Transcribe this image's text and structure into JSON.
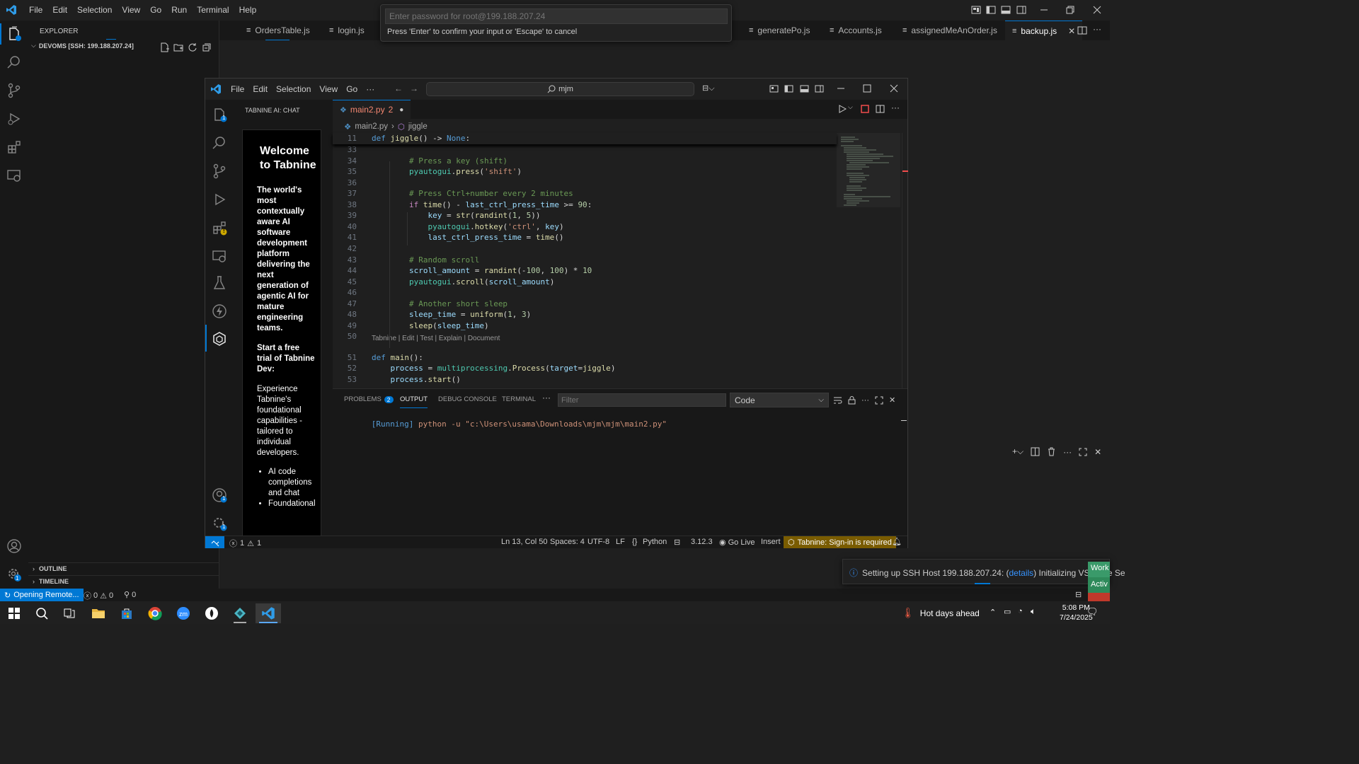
{
  "outer": {
    "menu": [
      "File",
      "Edit",
      "Selection",
      "View",
      "Go",
      "Run",
      "Terminal",
      "Help"
    ],
    "explorer_title": "EXPLORER",
    "folder_label": "DEVOMS [SSH: 199.188.207.24]",
    "outline_label": "OUTLINE",
    "timeline_label": "TIMELINE",
    "tabs": [
      "OrdersTable.js",
      "login.js",
      "generatePo.js",
      "Accounts.js",
      "assignedMeAnOrder.js",
      "backup.js"
    ],
    "status": {
      "remote": "Opening Remote...",
      "errors": "0",
      "warnings": "0",
      "ports": "0"
    },
    "accounts_badge": "1"
  },
  "quick_input": {
    "placeholder": "Enter password for root@199.188.207.24",
    "hint": "Press 'Enter' to confirm your input or 'Escape' to cancel"
  },
  "inner": {
    "menu": [
      "File",
      "Edit",
      "Selection",
      "View",
      "Go"
    ],
    "more": "···",
    "search_text": "mjm",
    "chat_title": "TABNINE AI: CHAT",
    "tab_label": "main2.py",
    "tab_problems": "2",
    "breadcrumb_file": "main2.py",
    "breadcrumb_symbol": "jiggle",
    "activity_badges": {
      "explorer": "1",
      "extensions": "!",
      "accounts": "1",
      "settings": "1"
    },
    "chat": {
      "heading": "Welcome to Tabnine",
      "tagline": "The world's most contextually aware AI software development platform delivering the next generation of agentic AI for mature engineering teams.",
      "cta": "Start a free trial of Tabnine Dev:",
      "body": "Experience Tabnine's foundational capabilities - tailored to individual developers.",
      "bullets": [
        "AI code completions and chat",
        "Foundational"
      ]
    },
    "sticky": {
      "ln": "11",
      "code": "def jiggle() -> None:"
    },
    "code_lens": "Tabnine | Edit | Test | Explain | Document",
    "code_lines": [
      {
        "ln": "33",
        "text": ""
      },
      {
        "ln": "34",
        "text": "        # Press a key (shift)"
      },
      {
        "ln": "35",
        "text": "        pyautogui.press('shift')"
      },
      {
        "ln": "36",
        "text": ""
      },
      {
        "ln": "37",
        "text": "        # Press Ctrl+number every 2 minutes"
      },
      {
        "ln": "38",
        "text": "        if time() - last_ctrl_press_time >= 90:"
      },
      {
        "ln": "39",
        "text": "            key = str(randint(1, 5))"
      },
      {
        "ln": "40",
        "text": "            pyautogui.hotkey('ctrl', key)"
      },
      {
        "ln": "41",
        "text": "            last_ctrl_press_time = time()"
      },
      {
        "ln": "42",
        "text": ""
      },
      {
        "ln": "43",
        "text": "        # Random scroll"
      },
      {
        "ln": "44",
        "text": "        scroll_amount = randint(-100, 100) * 10"
      },
      {
        "ln": "45",
        "text": "        pyautogui.scroll(scroll_amount)"
      },
      {
        "ln": "46",
        "text": ""
      },
      {
        "ln": "47",
        "text": "        # Another short sleep"
      },
      {
        "ln": "48",
        "text": "        sleep_time = uniform(1, 3)"
      },
      {
        "ln": "49",
        "text": "        sleep(sleep_time)"
      },
      {
        "ln": "50",
        "text": ""
      },
      {
        "ln": "51",
        "text": "def main():"
      },
      {
        "ln": "52",
        "text": "    process = multiprocessing.Process(target=jiggle)"
      },
      {
        "ln": "53",
        "text": "    process.start()"
      }
    ],
    "panel": {
      "tabs": [
        "PROBLEMS",
        "OUTPUT",
        "DEBUG CONSOLE",
        "TERMINAL"
      ],
      "problems_badge": "2",
      "filter_placeholder": "Filter",
      "channel": "Code",
      "output_running": "[Running]",
      "output_cmd": " python -u \"c:\\Users\\usama\\Downloads\\mjm\\mjm\\main2.py\""
    },
    "status": {
      "errors": "1",
      "warnings": "1",
      "position": "Ln 13, Col 50",
      "spaces": "Spaces: 4",
      "encoding": "UTF-8",
      "eol": "LF",
      "language": "Python",
      "py_version": "3.12.3",
      "golive": "Go Live",
      "mode": "Insert",
      "tabnine": "Tabnine: Sign-in is required"
    }
  },
  "notification": {
    "text_before": "Setting up SSH Host 199.188.207.24: (",
    "link": "details",
    "text_after": ") Initializing VS Code Se"
  },
  "side_badges": [
    "Work",
    "Activ"
  ],
  "taskbar": {
    "weather": "Hot days ahead",
    "time": "5:08 PM",
    "date": "7/24/2025"
  },
  "colors": {
    "accent": "#0078d4",
    "tabnine_status_bg": "#7a5c00",
    "badge": "#0078d4",
    "warning": "#cca700"
  }
}
